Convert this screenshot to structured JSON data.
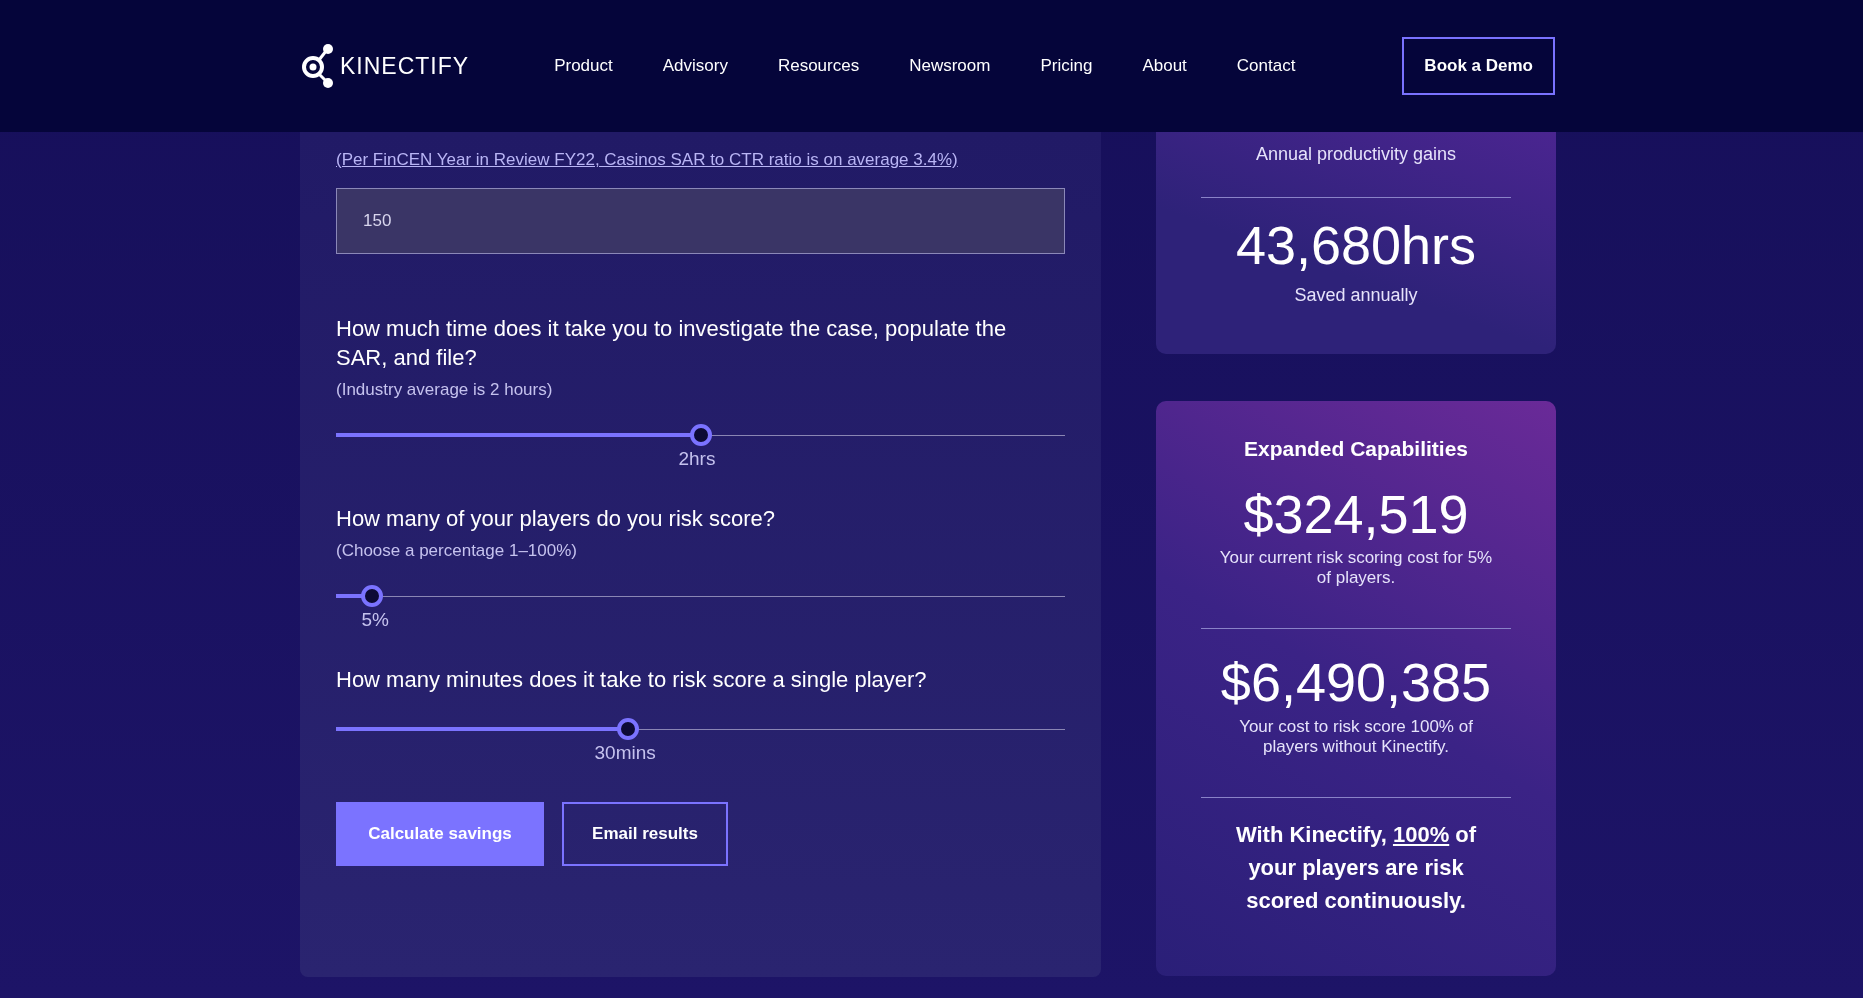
{
  "header": {
    "brand": "KINECTIFY",
    "nav": [
      "Product",
      "Advisory",
      "Resources",
      "Newsroom",
      "Pricing",
      "About",
      "Contact"
    ],
    "cta": "Book a Demo"
  },
  "calculator": {
    "source_link": "(Per FinCEN Year in Review FY22, Casinos SAR to CTR ratio is on average 3.4%)",
    "sars_value": "150",
    "questions": [
      {
        "question": "How much time does it take you to investigate the case, populate the SAR, and file?",
        "hint": "(Industry average is 2 hours)",
        "level": 0.5,
        "reading": "2hrs"
      },
      {
        "question": "How many of your players do you risk score?",
        "hint": "(Choose a percentage 1–100%)",
        "level": 0.05,
        "reading": "5%"
      },
      {
        "question": "How many minutes does it take to risk score a single player?",
        "level": 0.4,
        "reading": "30mins"
      }
    ],
    "buttons": [
      {
        "label": "Calculate savings",
        "kind": "primary"
      },
      {
        "label": "Email results",
        "kind": "outline"
      }
    ]
  },
  "productivity": {
    "title": "Annual productivity gains",
    "value": "43,680hrs",
    "caption": "Saved annually"
  },
  "capabilities": {
    "title": "Expanded Capabilities",
    "stats": [
      {
        "value": "$324,519",
        "caption": "Your current risk scoring cost for 5% of players."
      },
      {
        "value": "$6,490,385",
        "caption": "Your cost to risk score 100% of players without Kinectify."
      }
    ],
    "statement": {
      "before": "With Kinectify,",
      "highlight": "100%",
      "after": "of your players are risk scored continuously."
    }
  }
}
